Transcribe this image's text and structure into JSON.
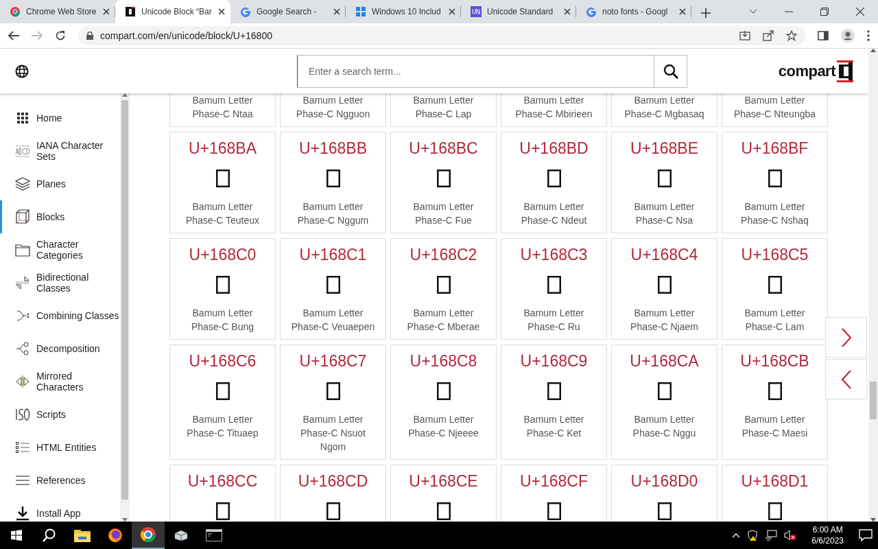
{
  "browser": {
    "tabs": [
      {
        "title": "Chrome Web Store",
        "selected": false
      },
      {
        "title": "Unicode Block “Bar",
        "selected": true
      },
      {
        "title": "Google Search -",
        "selected": false
      },
      {
        "title": "Windows 10 Includ",
        "selected": false
      },
      {
        "title": "Unicode Standard",
        "selected": false
      },
      {
        "title": "noto fonts - Googl",
        "selected": false
      }
    ],
    "url": "compart.com/en/unicode/block/U+16800"
  },
  "header": {
    "search": {
      "placeholder": "Enter a search term..."
    },
    "logo": "compart"
  },
  "sidebar": {
    "items": [
      {
        "label": "Home",
        "selected": false
      },
      {
        "label": "IANA Character Sets",
        "selected": false
      },
      {
        "label": "Planes",
        "selected": false
      },
      {
        "label": "Blocks",
        "selected": true
      },
      {
        "label": "Character Categories",
        "selected": false
      },
      {
        "label": "Bidirectional Classes",
        "selected": false
      },
      {
        "label": "Combining Classes",
        "selected": false
      },
      {
        "label": "Decomposition",
        "selected": false
      },
      {
        "label": "Mirrored Characters",
        "selected": false
      },
      {
        "label": "Scripts",
        "selected": false
      },
      {
        "label": "HTML Entities",
        "selected": false
      },
      {
        "label": "References",
        "selected": false
      },
      {
        "label": "Install App",
        "selected": false
      }
    ]
  },
  "grid": {
    "rows": [
      [
        {
          "name": "Bamum Letter Phase-C Ntaa"
        },
        {
          "name": "Bamum Letter Phase-C Ngguon"
        },
        {
          "name": "Bamum Letter Phase-C Lap"
        },
        {
          "name": "Bamum Letter Phase-C Mbirieen"
        },
        {
          "name": "Bamum Letter Phase-C Mgbasaq"
        },
        {
          "name": "Bamum Letter Phase-C Nteungba"
        }
      ],
      [
        {
          "code": "U+168BA",
          "name": "Bamum Letter Phase-C Teuteux"
        },
        {
          "code": "U+168BB",
          "name": "Bamum Letter Phase-C Nggum"
        },
        {
          "code": "U+168BC",
          "name": "Bamum Letter Phase-C Fue"
        },
        {
          "code": "U+168BD",
          "name": "Bamum Letter Phase-C Ndeut"
        },
        {
          "code": "U+168BE",
          "name": "Bamum Letter Phase-C Nsa"
        },
        {
          "code": "U+168BF",
          "name": "Bamum Letter Phase-C Nshaq"
        }
      ],
      [
        {
          "code": "U+168C0",
          "name": "Bamum Letter Phase-C Bung"
        },
        {
          "code": "U+168C1",
          "name": "Bamum Letter Phase-C Veuaepen"
        },
        {
          "code": "U+168C2",
          "name": "Bamum Letter Phase-C Mberae"
        },
        {
          "code": "U+168C3",
          "name": "Bamum Letter Phase-C Ru"
        },
        {
          "code": "U+168C4",
          "name": "Bamum Letter Phase-C Njaem"
        },
        {
          "code": "U+168C5",
          "name": "Bamum Letter Phase-C Lam"
        }
      ],
      [
        {
          "code": "U+168C6",
          "name": "Bamum Letter Phase-C Tituaep"
        },
        {
          "code": "U+168C7",
          "name": "Bamum Letter Phase-C Nsuot Ngom"
        },
        {
          "code": "U+168C8",
          "name": "Bamum Letter Phase-C Njeeee"
        },
        {
          "code": "U+168C9",
          "name": "Bamum Letter Phase-C Ket"
        },
        {
          "code": "U+168CA",
          "name": "Bamum Letter Phase-C Nggu"
        },
        {
          "code": "U+168CB",
          "name": "Bamum Letter Phase-C Maesi"
        }
      ],
      [
        {
          "code": "U+168CC"
        },
        {
          "code": "U+168CD"
        },
        {
          "code": "U+168CE"
        },
        {
          "code": "U+168CF"
        },
        {
          "code": "U+168D0"
        },
        {
          "code": "U+168D1"
        }
      ]
    ]
  },
  "taskbar": {
    "time": "6:00 AM",
    "date": "6/6/2023"
  }
}
